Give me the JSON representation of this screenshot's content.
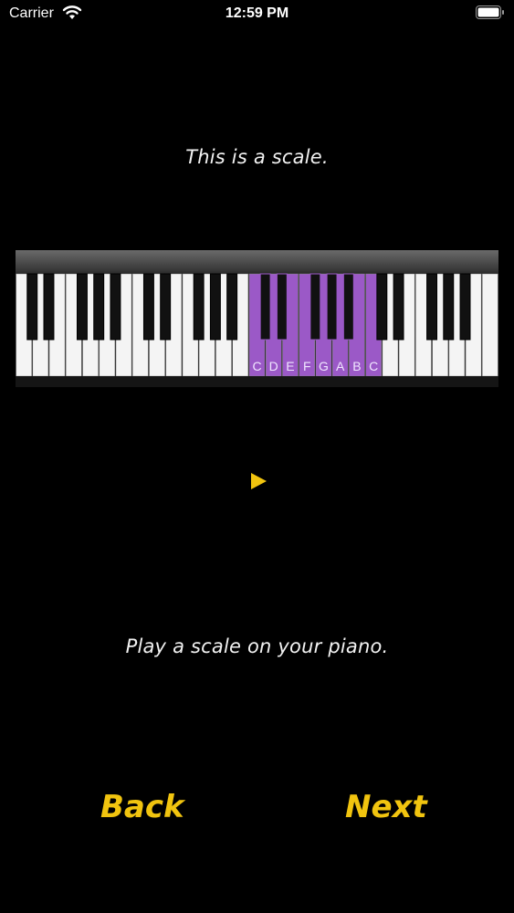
{
  "status_bar": {
    "carrier": "Carrier",
    "time": "12:59 PM"
  },
  "lesson": {
    "title_text": "This is a scale.",
    "instruction_text": "Play a scale on your piano."
  },
  "piano": {
    "highlight_color": "#9b59c7",
    "highlighted_notes": [
      "C",
      "D",
      "E",
      "F",
      "G",
      "A",
      "B",
      "C"
    ]
  },
  "controls": {
    "play_icon": "play-icon",
    "accent_color": "#f1c40f"
  },
  "navigation": {
    "back_label": "Back",
    "next_label": "Next"
  }
}
